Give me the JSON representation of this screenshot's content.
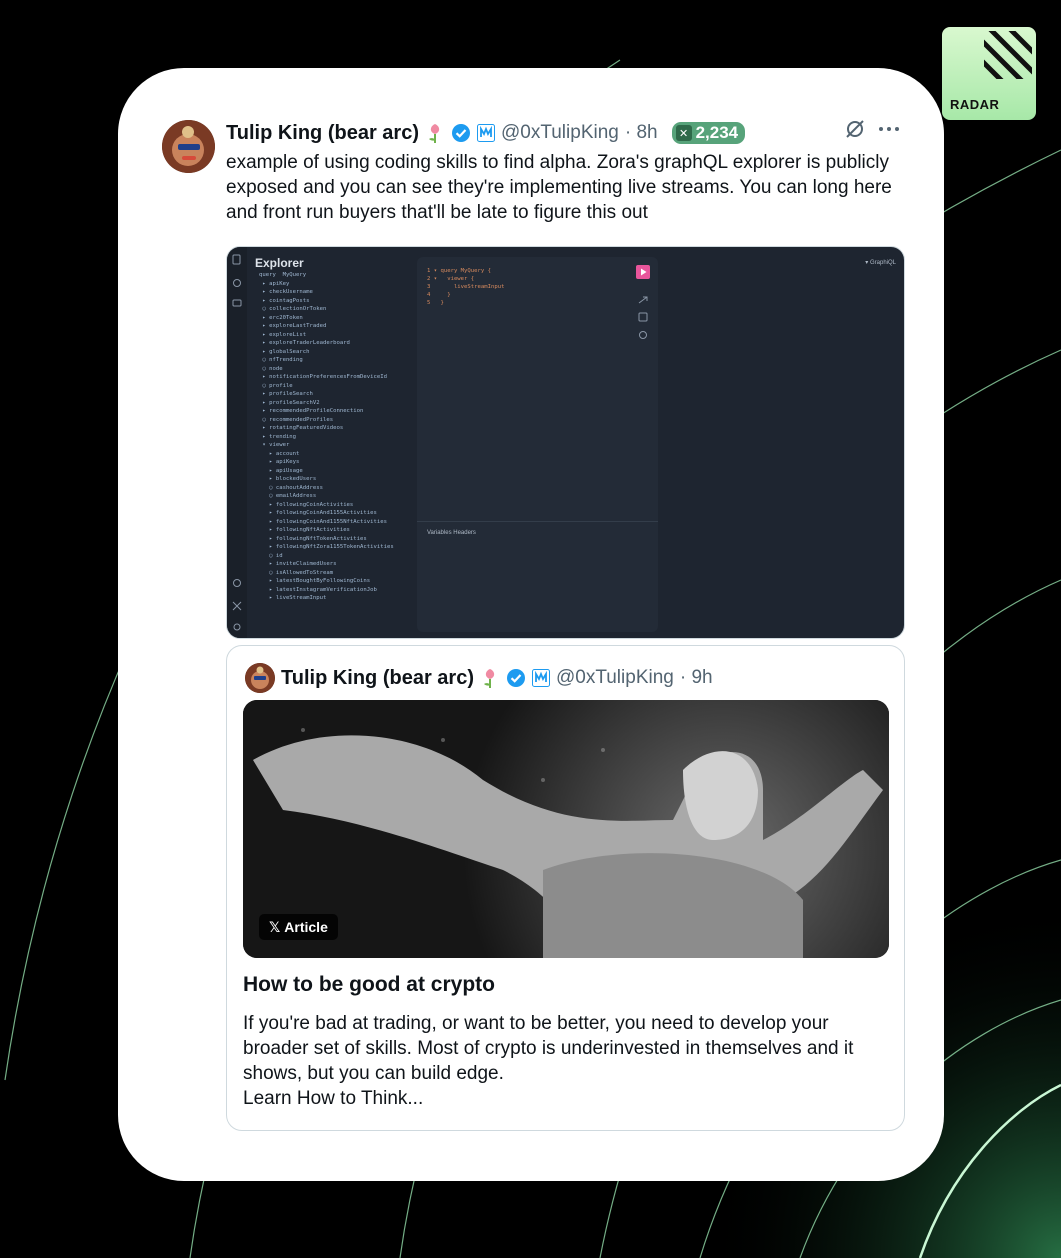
{
  "badge": {
    "label": "RADAR"
  },
  "tweet": {
    "name": "Tulip King (bear arc)",
    "handle": "@0xTulipKing",
    "time": "· 8h",
    "count": "2,234",
    "text": "example of using coding skills to find alpha. Zora's graphQL explorer is publicly exposed and you can see they're implementing live streams. You can long here and front run buyers that'll be late to figure this out"
  },
  "screenshot": {
    "explorer_title": "Explorer",
    "fields": "query  MyQuery\n ▸ apiKey\n ▸ checkUsername\n ▸ cointagPosts\n ◯ collectionOrToken\n ▸ erc20Token\n ▸ exploreLastTraded\n ▸ exploreList\n ▸ exploreTraderLeaderboard\n ▸ globalSearch\n ◯ nfTrending\n ◯ node\n ▸ notificationPreferencesFromDeviceId\n ◯ profile\n ▸ profileSearch\n ▸ profileSearchV2\n ▸ recommendedProfileConnection\n ◯ recommendedProfiles\n ▸ rotatingFeaturedVideos\n ▸ trending\n ▾ viewer\n   ▸ account\n   ▸ apiKeys\n   ▸ apiUsage\n   ▸ blockedUsers\n   ◯ cashoutAddress\n   ◯ emailAddress\n   ▸ followingCoinActivities\n   ▸ followingCoinAnd1155Activities\n   ▸ followingCoinAnd1155NftActivities\n   ▸ followingNftActivities\n   ▸ followingNftTokenActivities\n   ▸ followingNftZora1155TokenActivities\n   ◯ id\n   ▸ inviteClaimedUsers\n   ◯ isAllowedToStream\n   ▸ latestBoughtByFollowingCoins\n   ▸ latestInstagramVerificationJob\n   ▸ liveStreamInput",
    "code": "1 ▾ query MyQuery {\n2 ▾   viewer {\n3       liveStreamInput\n4     }\n5   }",
    "vars_tabs": "Variables    Headers",
    "graphql_label": "▾  GraphiQL"
  },
  "quote": {
    "name": "Tulip King (bear arc)",
    "handle": "@0xTulipKing",
    "time": "· 9h",
    "article_badge": "Article",
    "article_title": "How to be good at crypto",
    "article_body": "If you're bad at trading, or want to be better, you need to develop your broader set of skills. Most of crypto is underinvested in themselves and it shows, but you can build edge.\nLearn How to Think..."
  },
  "colors": {
    "accent": "#57a37a",
    "verified": "#1d9bf0"
  }
}
